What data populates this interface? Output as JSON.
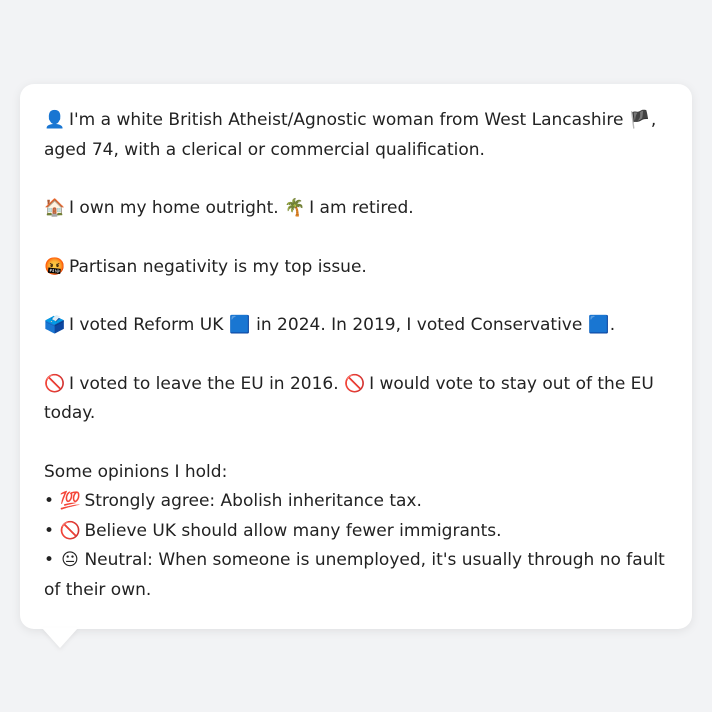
{
  "profile": {
    "intro": {
      "icon": "👤",
      "text": "I'm a white British Atheist/Agnostic woman from West Lancashire",
      "flag": "🏴",
      "text2": ", aged 74, with a clerical or commercial qualification."
    },
    "home": {
      "icon": "🏠",
      "text": "I own my home outright.",
      "icon2": "🌴",
      "text2": "I am retired."
    },
    "issue": {
      "icon": "🤬",
      "text": "Partisan negativity is my top issue."
    },
    "vote": {
      "icon": "🗳️",
      "text": "I voted Reform UK",
      "party_icon": "🟦",
      "text2": "in 2024. In 2019, I voted Conservative",
      "party_icon2": "🟦",
      "text3": "."
    },
    "eu": {
      "icon": "🚫",
      "text": "I voted to leave the EU in 2016.",
      "icon2": "🚫",
      "text2": "I would vote to stay out of the EU today."
    },
    "opinions": {
      "heading": "Some opinions I hold:",
      "items": [
        {
          "bullet": "•",
          "icon": "💯",
          "text": "Strongly agree: Abolish inheritance tax."
        },
        {
          "bullet": "•",
          "icon": "🚫",
          "text": "Believe UK should allow many fewer immigrants."
        },
        {
          "bullet": "•",
          "icon": "😐",
          "text": "Neutral: When someone is unemployed, it's usually through no fault of their own."
        }
      ]
    }
  }
}
